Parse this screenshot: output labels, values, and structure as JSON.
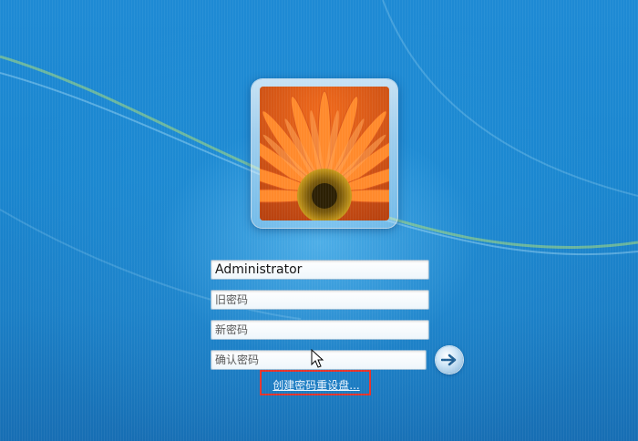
{
  "login": {
    "username": "Administrator",
    "old_password_placeholder": "旧密码",
    "new_password_placeholder": "新密码",
    "confirm_password_placeholder": "确认密码",
    "reset_disk_link": "创建密码重设盘..."
  },
  "icons": {
    "submit": "arrow-right-icon",
    "avatar": "flower-avatar",
    "cursor": "mouse-pointer-icon"
  },
  "colors": {
    "background": "#1b7fc6",
    "highlight": "#e8332a",
    "link": "#eaf5ff"
  }
}
